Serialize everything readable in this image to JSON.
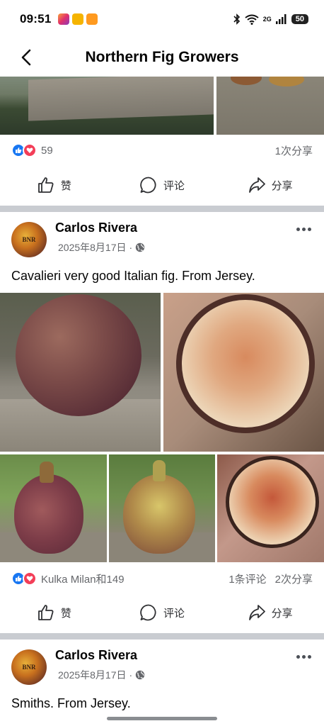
{
  "status_bar": {
    "time": "09:51",
    "signal_label": "2G",
    "battery": "50"
  },
  "header": {
    "title": "Northern Fig Growers"
  },
  "previous_post": {
    "reaction_count": "59",
    "shares": "1次分享"
  },
  "actions": {
    "like": "赞",
    "comment": "评论",
    "share": "分享"
  },
  "posts": [
    {
      "author": "Carlos Rivera",
      "date": "2025年8月17日",
      "separator": "·",
      "avatar_text": "BNR",
      "text": "Cavalieri very good Italian fig. From Jersey.",
      "reactions_label": "Kulka Milan和149",
      "comments": "1条评论",
      "shares": "2次分享"
    },
    {
      "author": "Carlos Rivera",
      "date": "2025年8月17日",
      "separator": "·",
      "avatar_text": "BNR",
      "text": "Smiths. From Jersey."
    }
  ],
  "colors": {
    "like_blue": "#1877f2",
    "love_red": "#f33e58",
    "divider": "#c9ccd1",
    "meta_gray": "#65676b"
  }
}
